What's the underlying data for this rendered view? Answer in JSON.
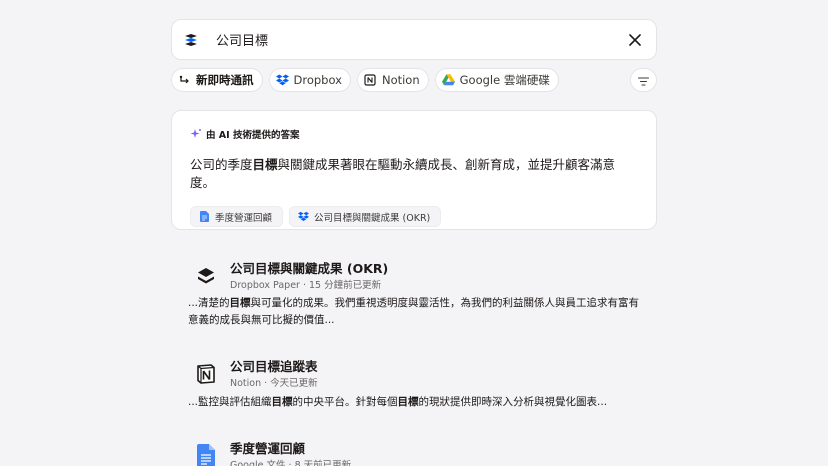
{
  "search": {
    "query": "公司目標"
  },
  "filters": [
    {
      "label": "新即時通訊",
      "icon": "message-arrow-icon",
      "bold": true
    },
    {
      "label": "Dropbox",
      "icon": "dropbox-icon"
    },
    {
      "label": "Notion",
      "icon": "notion-icon"
    },
    {
      "label": "Google 雲端硬碟",
      "icon": "google-drive-icon"
    }
  ],
  "ai_card": {
    "header": "由 AI 技術提供的答案",
    "answer_pre": "公司的季度",
    "answer_bold": "目標",
    "answer_post": "與關鍵成果著眼在驅動永續成長、創新育成，並提升顧客滿意度。",
    "sources": [
      {
        "label": "季度營運回顧",
        "icon": "google-docs-icon"
      },
      {
        "label": "公司目標與關鍵成果 (OKR)",
        "icon": "dropbox-icon"
      }
    ]
  },
  "results": [
    {
      "title": "公司目標與關鍵成果 (OKR)",
      "meta": "Dropbox Paper · 15 分鐘前已更新",
      "snippet_a": "...清楚的",
      "snippet_b": "目標",
      "snippet_c": "與可量化的成果。我們重視透明度與靈活性，為我們的利益關係人與員工追求有富有意義的成長與無可比擬的價值...",
      "icon": "dropbox-paper-icon"
    },
    {
      "title": "公司目標追蹤表",
      "meta": "Notion · 今天已更新",
      "snippet_a": "...監控與評估組織",
      "snippet_b": "目標",
      "snippet_c": "的中央平台。針對每個",
      "snippet_d": "目標",
      "snippet_e": "的現狀提供即時深入分析與視覺化圖表...",
      "icon": "notion-icon"
    },
    {
      "title": "季度營運回顧",
      "meta": "Google 文件 · 8 天前已更新",
      "icon": "google-docs-icon"
    }
  ],
  "colors": {
    "background": "#f4f4f6",
    "dropbox_blue": "#0061fe",
    "google_docs_blue": "#4285f4",
    "ai_purple": "#7b61ff"
  }
}
